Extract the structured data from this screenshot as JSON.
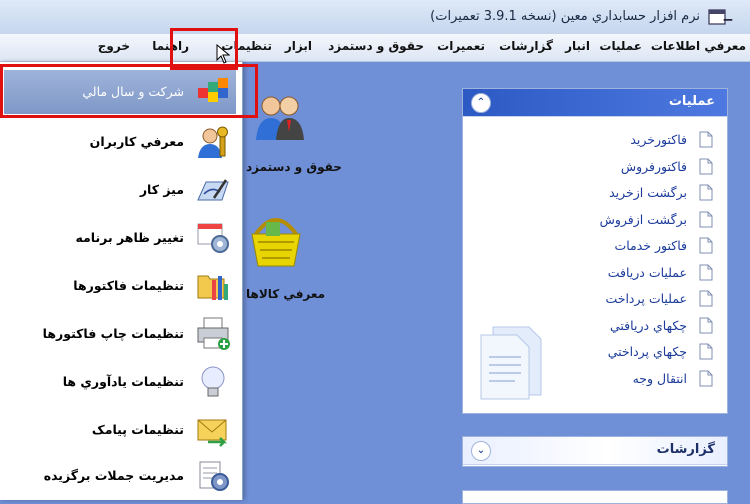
{
  "window": {
    "title": "نرم افزار حسابداري معين (نسخه 3.9.1 تعميرات)"
  },
  "menubar": {
    "items": [
      "معرفي اطلاعات",
      "عمليات",
      "انبار",
      "گزارشات",
      "تعميرات",
      "حقوق و دستمزد",
      "ابزار",
      "تنظيمات",
      "راهنما",
      "خروج"
    ]
  },
  "dropdown": {
    "items": [
      {
        "label": "شرکت و سال مالي",
        "icon": "company-year-icon",
        "selected": true
      },
      {
        "label": "معرفي کاربران",
        "icon": "users-key-icon"
      },
      {
        "label": "ميز کار",
        "icon": "desktop-pen-icon"
      },
      {
        "label": "تغيير ظاهر برنامه",
        "icon": "appearance-gear-icon"
      },
      {
        "label": "تنظيمات فاکتورها",
        "icon": "invoice-settings-icon"
      },
      {
        "label": "تنظيمات چاپ فاکتورها",
        "icon": "printer-add-icon"
      },
      {
        "label": "تنظيمات يادآوري ها",
        "icon": "lightbulb-icon"
      },
      {
        "label": "تنظيمات پيامک",
        "icon": "sms-envelope-icon"
      },
      {
        "label": "مديريت جملات برگزيده",
        "icon": "phrases-gear-icon"
      }
    ]
  },
  "desktop": {
    "icons": [
      {
        "label": "حقوق و دستمزد",
        "icon": "payroll-people-icon"
      },
      {
        "label": "معرفي کالاها",
        "icon": "goods-basket-icon"
      }
    ]
  },
  "panels": {
    "operations": {
      "title": "عمليات",
      "items": [
        "فاکتورخريد",
        "فاکتورفروش",
        "برگشت ازخريد",
        "برگشت ازفروش",
        "فاکتور خدمات",
        "عمليات دريافت",
        "عمليات پرداخت",
        "چکهاي دريافتي",
        "چکهاي پرداختي",
        "انتقال وجه"
      ]
    },
    "reports": {
      "title": "گزارشات"
    }
  },
  "colors": {
    "highlight": "#e01010",
    "panel_head": "#2d59c4",
    "workspace": "#6f8fd6"
  }
}
